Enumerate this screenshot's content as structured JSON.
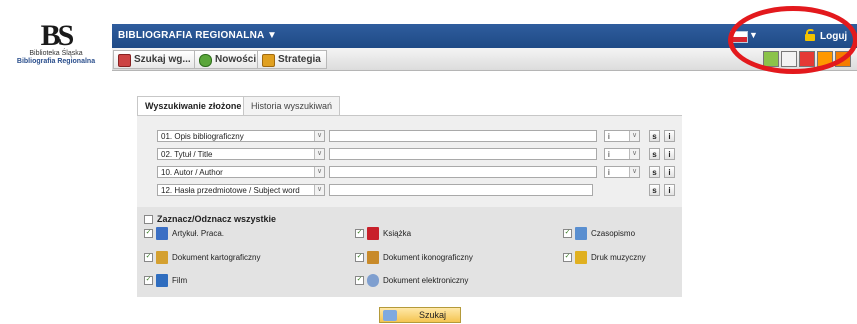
{
  "logo": {
    "mark": "BS",
    "line1": "Biblioteka Śląska",
    "line2": "Bibliografia Regionalna"
  },
  "header": {
    "title": "BIBLIOGRAFIA REGIONALNA ▼",
    "login_label": "Loguj"
  },
  "tabs": [
    {
      "label": "Szukaj wg...",
      "icon": "search-book-icon"
    },
    {
      "label": "Nowości",
      "icon": "news-icon"
    },
    {
      "label": "Strategia",
      "icon": "strategy-icon"
    }
  ],
  "toolbar_icons": [
    "chart-icon",
    "export-icon",
    "print-icon",
    "home-icon",
    "help-icon"
  ],
  "search_tabs": [
    {
      "label": "Wyszukiwanie złożone",
      "active": true
    },
    {
      "label": "Historia wyszukiwań",
      "active": false
    }
  ],
  "rows": [
    {
      "field": "01. Opis bibliograficzny",
      "value": "",
      "operator": "i"
    },
    {
      "field": "02. Tytuł / Title",
      "value": "",
      "operator": "i"
    },
    {
      "field": "10. Autor / Author",
      "value": "",
      "operator": "i"
    },
    {
      "field": "12. Hasła przedmiotowe / Subject word",
      "value": "",
      "operator": ""
    }
  ],
  "row_buttons": {
    "s": "s",
    "i": "i"
  },
  "select_all": "Zaznacz/Odznacz wszystkie",
  "doc_types": [
    {
      "label": "Artykuł. Praca.",
      "icon": "article-icon",
      "color": "#3b6fc4"
    },
    {
      "label": "Książka",
      "icon": "book-icon",
      "color": "#c8202a"
    },
    {
      "label": "Czasopismo",
      "icon": "magazine-icon",
      "color": "#5a8fd0"
    },
    {
      "label": "Dokument kartograficzny",
      "icon": "map-icon",
      "color": "#d4a030"
    },
    {
      "label": "Dokument ikonograficzny",
      "icon": "image-icon",
      "color": "#c88a2a"
    },
    {
      "label": "Druk muzyczny",
      "icon": "music-icon",
      "color": "#e0b020"
    },
    {
      "label": "Film",
      "icon": "film-icon",
      "color": "#2f6dbf"
    },
    {
      "label": "Dokument elektroniczny",
      "icon": "cd-icon",
      "color": "#7f9fcf"
    }
  ],
  "search_button": "Szukaj",
  "colors": {
    "header": "#2a5596",
    "highlight_ring": "#e3191d"
  }
}
